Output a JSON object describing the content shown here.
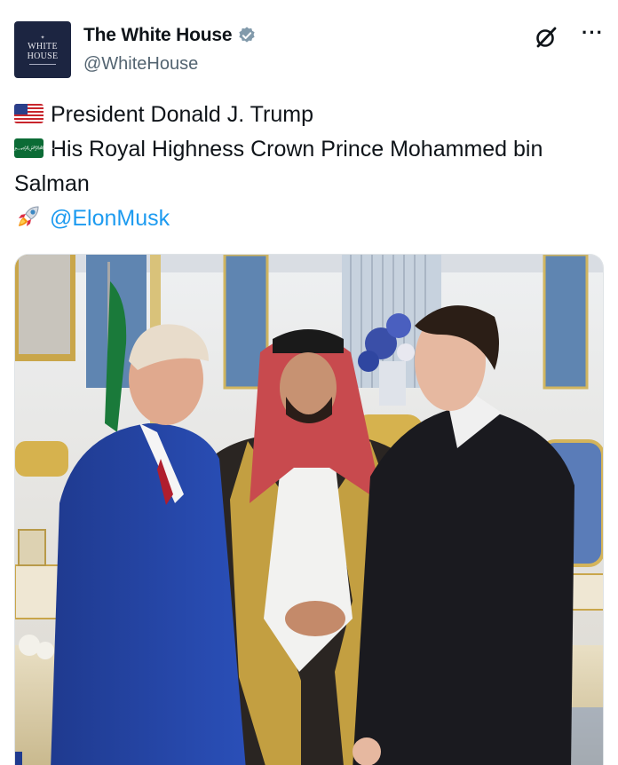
{
  "account": {
    "avatar_lines": [
      "WHITE",
      "HOUSE"
    ],
    "name": "The White House",
    "handle": "@WhiteHouse",
    "verified_badge_color": "#829aab"
  },
  "post": {
    "lines": [
      {
        "icon": "us-flag-icon",
        "text": "President Donald J. Trump"
      },
      {
        "icon": "saudi-flag-icon",
        "text": "His Royal Highness Crown Prince Mohammed bin Salman"
      },
      {
        "icon": "rocket-icon",
        "text": "@ElonMusk"
      }
    ],
    "mention_color": "#1d9bf0"
  },
  "actions": {
    "more_label": "···",
    "grok_icon": "grok-icon"
  },
  "media": {
    "description_icon": "photo"
  }
}
